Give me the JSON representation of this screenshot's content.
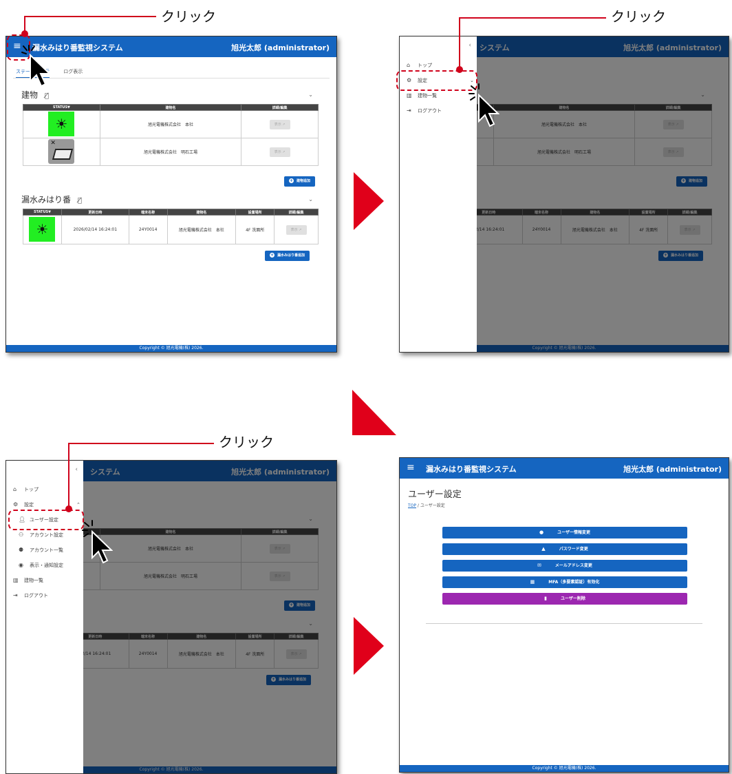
{
  "annotations": {
    "click_label": "クリック"
  },
  "app": {
    "menu_icon": "≡",
    "title": "漏水みはり番監視システム",
    "title_partial": "システム",
    "user": "旭光太郎 (administrator)",
    "footer": "Copyright © 旭光電機(株) 2026."
  },
  "tabs": [
    "ステータス表示",
    "ログ表示"
  ],
  "buildings": {
    "title": "建物",
    "headers": [
      "STATUS▼",
      "建物名",
      "詳細/編集"
    ],
    "rows": [
      {
        "status": "on",
        "name": "旭光電機株式会社　本社",
        "detail": "表示 ↗"
      },
      {
        "status": "off",
        "name": "旭光電機株式会社　明石工場",
        "detail": "表示 ↗"
      }
    ],
    "add_button": "建物追加"
  },
  "sensors": {
    "title": "漏水みはり番",
    "headers": [
      "STATUS▼",
      "更新日時",
      "端末名称",
      "建物名",
      "設置場所",
      "詳細/編集"
    ],
    "rows": [
      {
        "status": "on",
        "updated": "2026/02/14 16:24:01",
        "updated_partial": "02/14 16:24:01",
        "terminal": "24Y0014",
        "building": "旭光電機株式会社　本社",
        "location": "4F 洗面所",
        "detail": "表示 ↗"
      }
    ],
    "add_button": "漏水みはり番追加"
  },
  "drawer": {
    "top": "トップ",
    "settings": "設定",
    "building_list": "建物一覧",
    "logout": "ログアウト",
    "sub": [
      "ユーザー設定",
      "アカウント設定",
      "アカウント一覧",
      "表示・通知設定"
    ]
  },
  "user_settings": {
    "title": "ユーザー設定",
    "crumb_top": "TOP",
    "crumb_sep": " / ",
    "crumb_current": "ユーザー設定",
    "buttons": [
      {
        "label": "ユーザー情報変更",
        "icon": "person-icon",
        "color": "#1565c0"
      },
      {
        "label": "パスワード変更",
        "icon": "lock-icon",
        "color": "#1565c0"
      },
      {
        "label": "メールアドレス変更",
        "icon": "mail-icon",
        "color": "#1565c0"
      },
      {
        "label": "MFA（多要素認証）有効化",
        "icon": "qr-icon",
        "color": "#1565c0"
      },
      {
        "label": "ユーザー削除",
        "icon": "trash-icon",
        "color": "#9c27b0"
      }
    ]
  },
  "colors": {
    "primary": "#1565c0",
    "accent_red": "#d0021b",
    "status_on": "#22ee22",
    "danger_purple": "#9c27b0"
  }
}
